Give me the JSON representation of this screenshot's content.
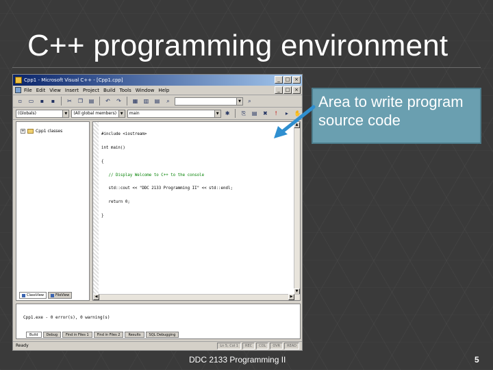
{
  "slide": {
    "title": "C++ programming environment",
    "footer": "DDC 2133 Programming II",
    "page_number": "5"
  },
  "callout": {
    "text": "Area to write program source code",
    "color": "#6a9fb0"
  },
  "ide": {
    "window_title": "Cpp1 - Microsoft Visual C++ - [Cpp1.cpp]",
    "window_buttons": [
      "_",
      "□",
      "×"
    ],
    "menu_items": [
      "File",
      "Edit",
      "View",
      "Insert",
      "Project",
      "Build",
      "Tools",
      "Window",
      "Help"
    ],
    "toolbar_combo_1": "(Globals)",
    "toolbar_combo_2": "(All global members)",
    "toolbar_combo_3": "main",
    "workspace_tree_label": "Cpp1 classes",
    "workspace_tabs": [
      "ClassView",
      "FileView"
    ],
    "code_lines": [
      "#include <iostream>",
      "int main()",
      "{",
      "   // Display Welcome to C++ to the console",
      "   std::cout << \"DDC 2133 Programming II\" << std::endl;",
      "   return 0;",
      "}"
    ],
    "output_text": "Cpp1.exe - 0 error(s), 0 warning(s)",
    "output_tabs": [
      "Build",
      "Debug",
      "Find in Files 1",
      "Find in Files 2",
      "Results",
      "SQL Debugging"
    ],
    "status_text": "Ready",
    "status_cells": [
      "Ln 5, Col 1",
      "REC",
      "COL",
      "OVR",
      "READ"
    ]
  },
  "icons": [
    "app-icon",
    "arrow-icon"
  ]
}
